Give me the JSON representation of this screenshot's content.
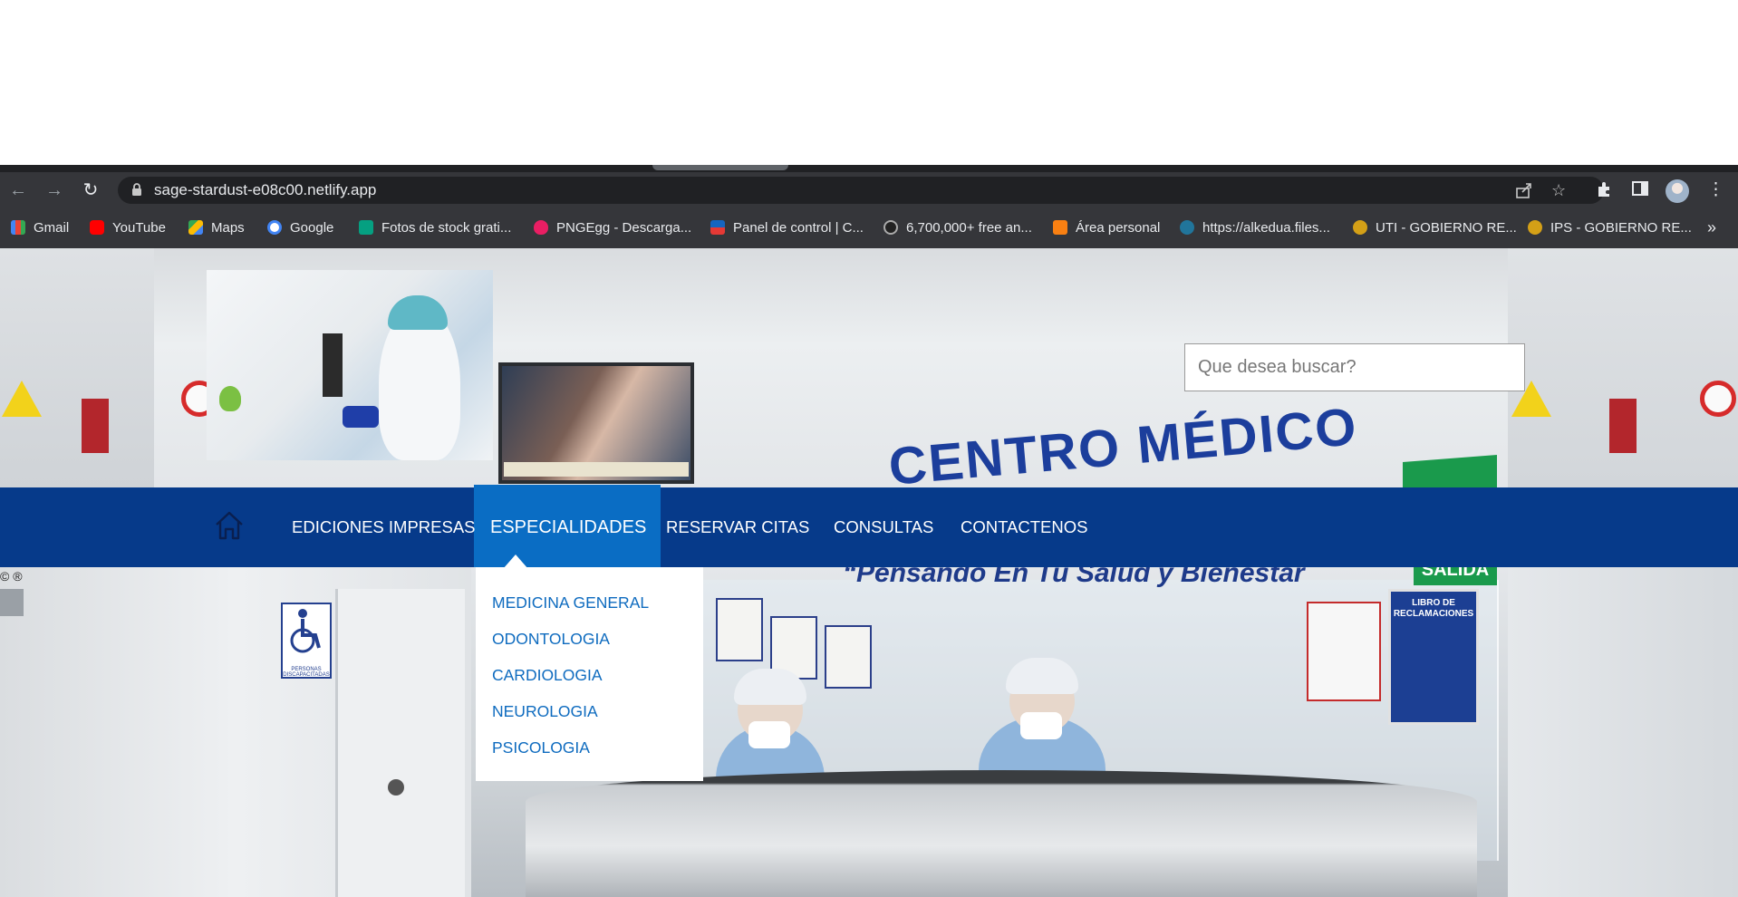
{
  "browser": {
    "url": "sage-stardust-e08c00.netlify.app",
    "bookmarks": [
      {
        "label": "Gmail",
        "icon": "gmail-icon",
        "color": "#ea4335"
      },
      {
        "label": "YouTube",
        "icon": "youtube-icon",
        "color": "#ff0000"
      },
      {
        "label": "Maps",
        "icon": "maps-icon",
        "color": "#34a853"
      },
      {
        "label": "Google",
        "icon": "google-icon",
        "color": "#ffffff"
      },
      {
        "label": "Fotos de stock grati...",
        "icon": "pexels-icon",
        "color": "#05a081"
      },
      {
        "label": "PNGEgg - Descarga...",
        "icon": "pngegg-icon",
        "color": "#e91e63"
      },
      {
        "label": "Panel de control | C...",
        "icon": "panel-icon",
        "color": "#1565c0"
      },
      {
        "label": "6,700,000+ free an...",
        "icon": "freepik-icon",
        "color": "#222222"
      },
      {
        "label": "Área personal",
        "icon": "moodle-icon",
        "color": "#f98012"
      },
      {
        "label": "https://alkedua.files...",
        "icon": "wordpress-icon",
        "color": "#21759b"
      },
      {
        "label": "UTI - GOBIERNO RE...",
        "icon": "gobierno-icon",
        "color": "#d4a017"
      },
      {
        "label": "IPS - GOBIERNO RE...",
        "icon": "gobierno-icon",
        "color": "#d4a017"
      }
    ],
    "more_bookmarks": "»"
  },
  "header": {
    "search_placeholder": "Que desea buscar?",
    "sign_text": "CENTRO MÉDICO"
  },
  "nav": {
    "items": [
      {
        "label": "EDICIONES IMPRESAS",
        "active": false
      },
      {
        "label": "ESPECIALIDADES",
        "active": true
      },
      {
        "label": "RESERVAR CITAS",
        "active": false
      },
      {
        "label": "CONSULTAS",
        "active": false
      },
      {
        "label": "CONTACTENOS",
        "active": false
      }
    ],
    "dropdown": [
      "MEDICINA GENERAL",
      "ODONTOLOGIA",
      "CARDIOLOGIA",
      "NEUROLOGIA",
      "PSICOLOGIA"
    ]
  },
  "hero": {
    "copyright": "© ®",
    "motto": "“Pensando En Tu Salud y Bienestar",
    "salida": "SALIDA",
    "libro": "LIBRO DE RECLAMACIONES",
    "discapacitados": "PERSONAS DISCAPACITADAS"
  },
  "colors": {
    "navbar": "#063a8a",
    "nav_active": "#0a6dc4",
    "dropdown_text": "#0e6bbf",
    "chrome": "#35363a"
  }
}
